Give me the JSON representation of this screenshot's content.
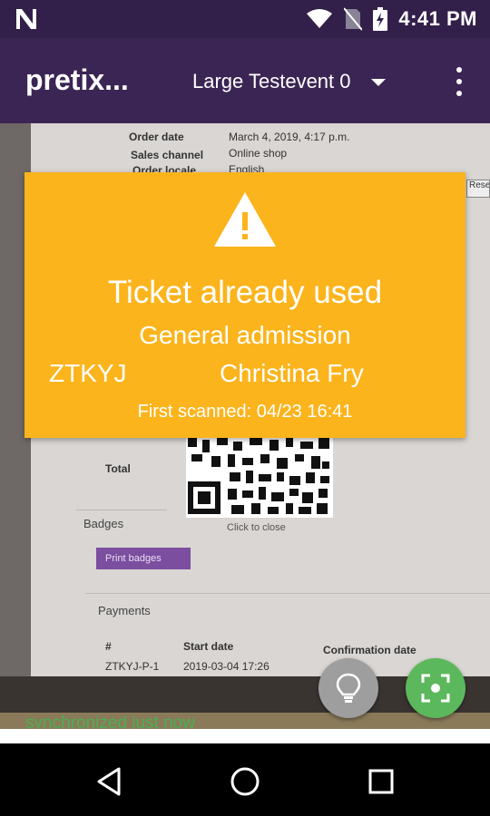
{
  "status_bar": {
    "time": "4:41 PM",
    "icons": [
      "n-notification-icon",
      "wifi-icon",
      "no-sim-icon",
      "battery-charging-icon"
    ]
  },
  "toolbar": {
    "title": "pretix...",
    "event_name": "Large Testevent 0",
    "icons": [
      "dropdown-caret-icon",
      "overflow-menu-icon"
    ]
  },
  "camera_preview": {
    "document": {
      "order_date_label": "Order date",
      "order_date_value": "March 4, 2019, 4:17 p.m.",
      "sales_channel_label": "Sales channel",
      "sales_channel_value": "Online shop",
      "order_locale_label": "Order locale",
      "order_locale_value": "English",
      "total_label": "Total",
      "badges_label": "Badges",
      "print_badges_label": "Print badges",
      "qr_caption": "Click to close",
      "payments_label": "Payments",
      "start_date_label": "Start date",
      "confirmation_date_label": "Confirmation date",
      "reset_label": "Rese",
      "payment_id": "ZTKYJ-P-1",
      "payment_date": "2019-03-04 17:26",
      "hash": "#"
    }
  },
  "result": {
    "title": "Ticket already used",
    "product": "General admission",
    "order_code": "ZTKYJ",
    "attendee_name": "Christina Fry",
    "first_scanned": "First scanned: 04/23 16:41",
    "background_color": "#fbb41c",
    "icon": "warning-icon"
  },
  "sync_status": "synchronized just now",
  "fabs": {
    "flashlight_icon": "lightbulb-icon",
    "scan_icon": "scan-focus-icon",
    "scan_color": "#5cb85c"
  },
  "nav_bar": {
    "icons": [
      "back-icon",
      "home-icon",
      "recents-icon"
    ]
  }
}
